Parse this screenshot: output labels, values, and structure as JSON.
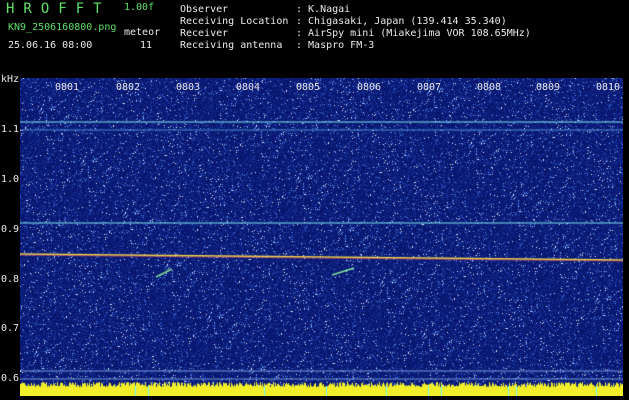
{
  "header": {
    "app_name": "HROFFT",
    "version": "1.00f",
    "filename": "KN9_2506160800.png",
    "meteor_label": "meteor",
    "datetime": "25.06.16 08:00",
    "meteor_count": "11"
  },
  "meta": [
    {
      "label": "Observer",
      "value": ": K.Nagai"
    },
    {
      "label": "Receiving Location",
      "value": ": Chigasaki, Japan (139.414 35.340)"
    },
    {
      "label": "Receiver",
      "value": ": AirSpy mini (Miakejima VOR 108.65MHz)"
    },
    {
      "label": "Receiving antenna",
      "value": ": Maspro FM-3"
    }
  ],
  "spectrogram": {
    "y_unit": "kHz",
    "y_ticks": [
      "1.1",
      "1.0",
      "0.9",
      "0.8",
      "0.7",
      "0.6"
    ],
    "x_ticks": [
      "0801",
      "0802",
      "0803",
      "0804",
      "0805",
      "0806",
      "0807",
      "0808",
      "0809",
      "0810"
    ],
    "colors": {
      "background": "#0a1a6e",
      "signal": "#ffffff",
      "carrier": "#e8d84a",
      "baseline": "#f2ef2a"
    }
  }
}
